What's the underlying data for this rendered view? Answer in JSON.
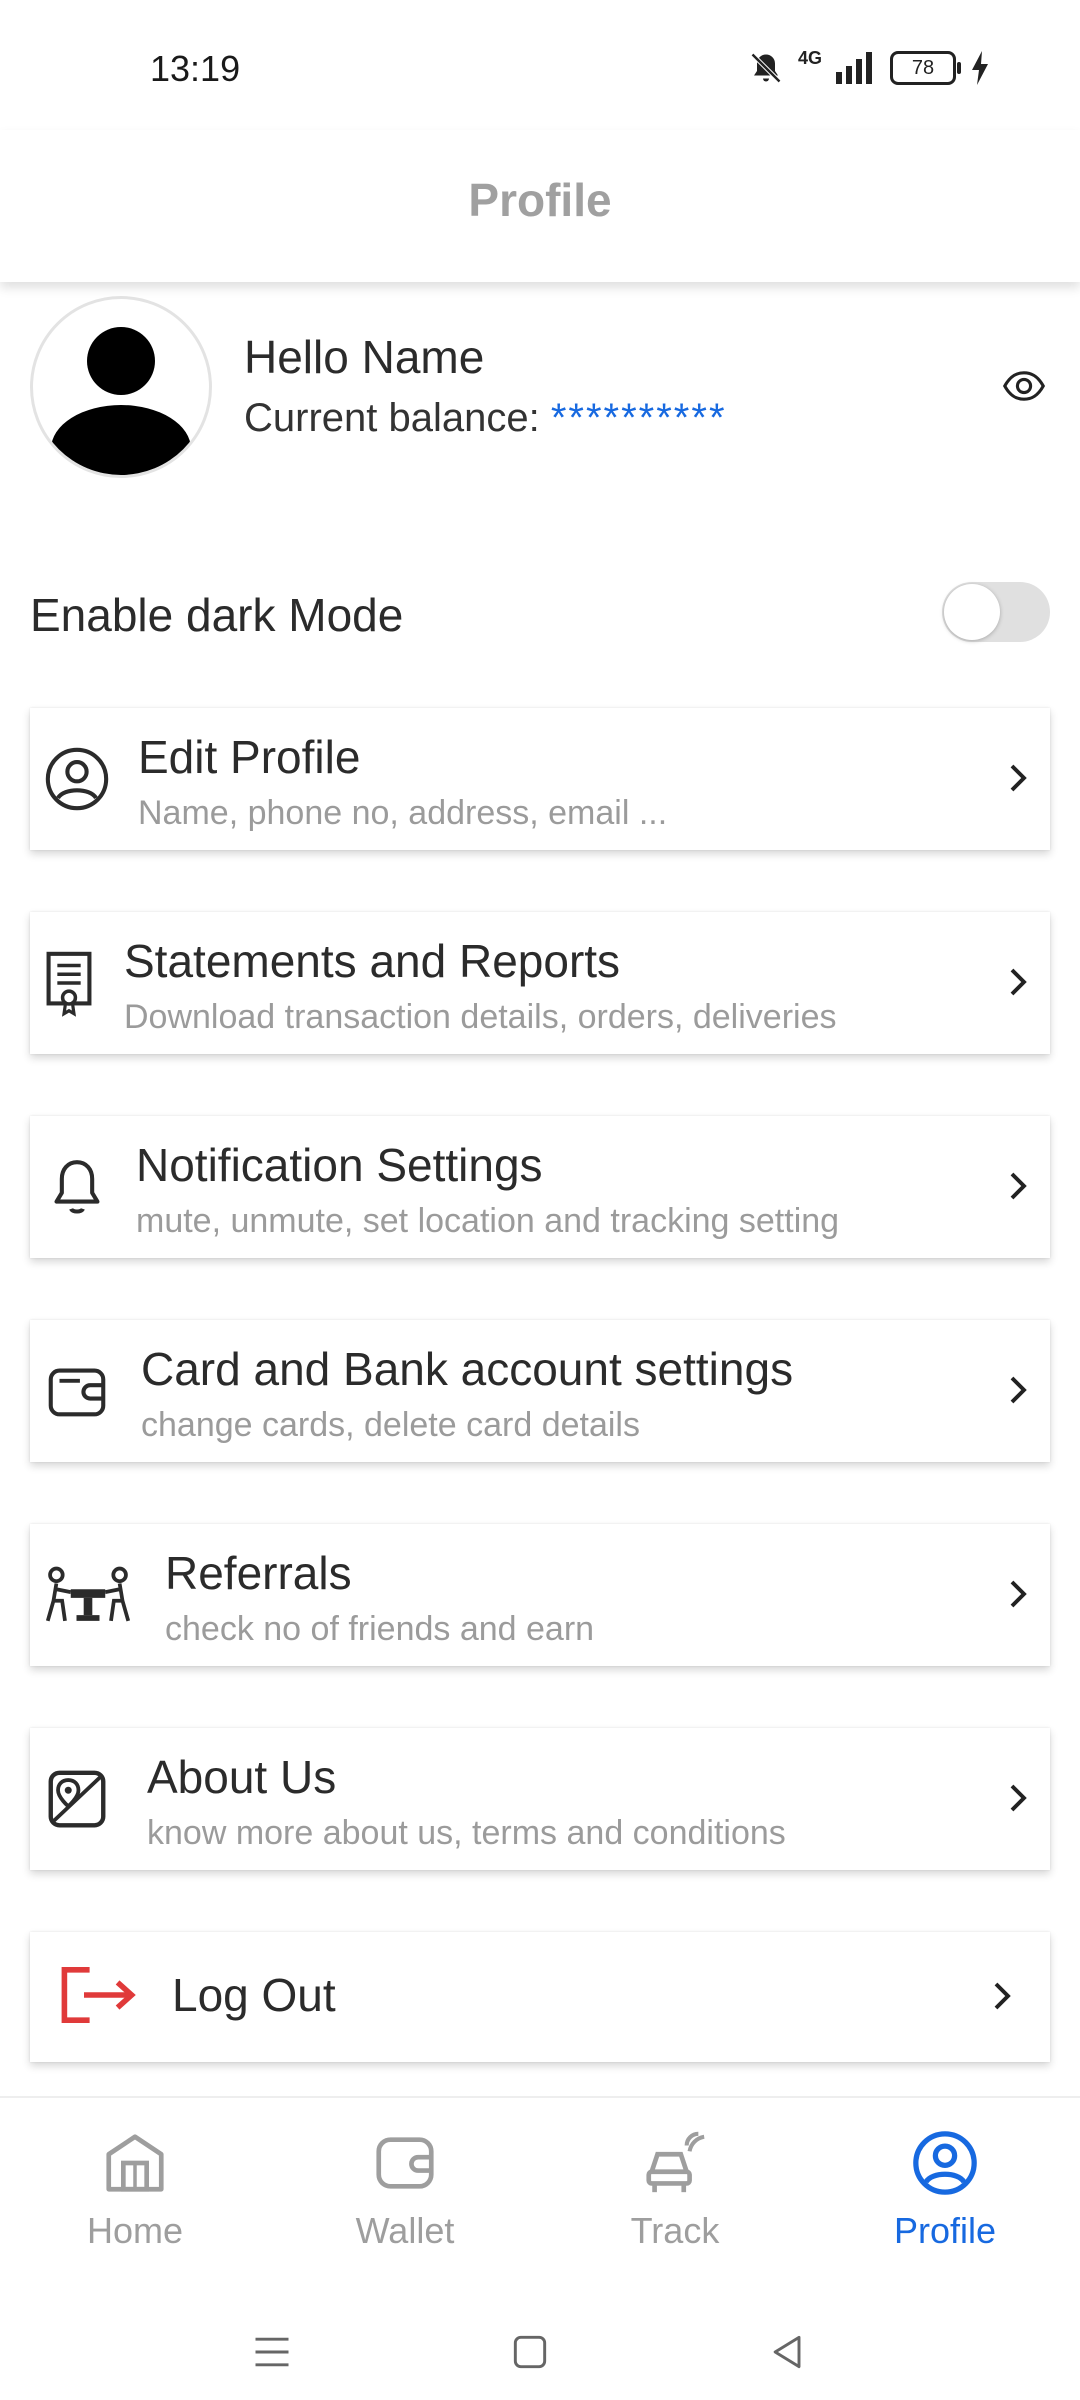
{
  "status": {
    "time": "13:19",
    "network": "4G",
    "battery": "78"
  },
  "header": {
    "title": "Profile"
  },
  "profile": {
    "greeting": "Hello Name",
    "balance_label": "Current balance: ",
    "balance_value": "**********"
  },
  "dark_mode": {
    "label": "Enable dark Mode",
    "enabled": false
  },
  "menu": [
    {
      "title": "Edit Profile",
      "subtitle": "Name, phone no, address, email ...",
      "icon": "user-circle-icon"
    },
    {
      "title": "Statements and Reports",
      "subtitle": "Download transaction details, orders, deliveries",
      "icon": "certificate-document-icon"
    },
    {
      "title": "Notification Settings",
      "subtitle": "mute, unmute, set location and tracking setting",
      "icon": "bell-icon"
    },
    {
      "title": "Card and Bank account settings",
      "subtitle": "change cards, delete card details",
      "icon": "wallet-icon"
    },
    {
      "title": "Referrals",
      "subtitle": "check no of friends and earn",
      "icon": "people-table-icon"
    },
    {
      "title": "About Us",
      "subtitle": "know more about us, terms and conditions",
      "icon": "map-pin-icon"
    }
  ],
  "logout": {
    "label": "Log Out",
    "icon": "logout-icon",
    "color": "#e03a3a"
  },
  "bottom_nav": [
    {
      "label": "Home",
      "icon": "home-icon",
      "active": false
    },
    {
      "label": "Wallet",
      "icon": "wallet-icon",
      "active": false
    },
    {
      "label": "Track",
      "icon": "car-signal-icon",
      "active": false
    },
    {
      "label": "Profile",
      "icon": "user-circle-icon",
      "active": true
    }
  ],
  "colors": {
    "accent": "#1769e0",
    "muted": "#9e9e9e",
    "text": "#2b2b2b"
  }
}
